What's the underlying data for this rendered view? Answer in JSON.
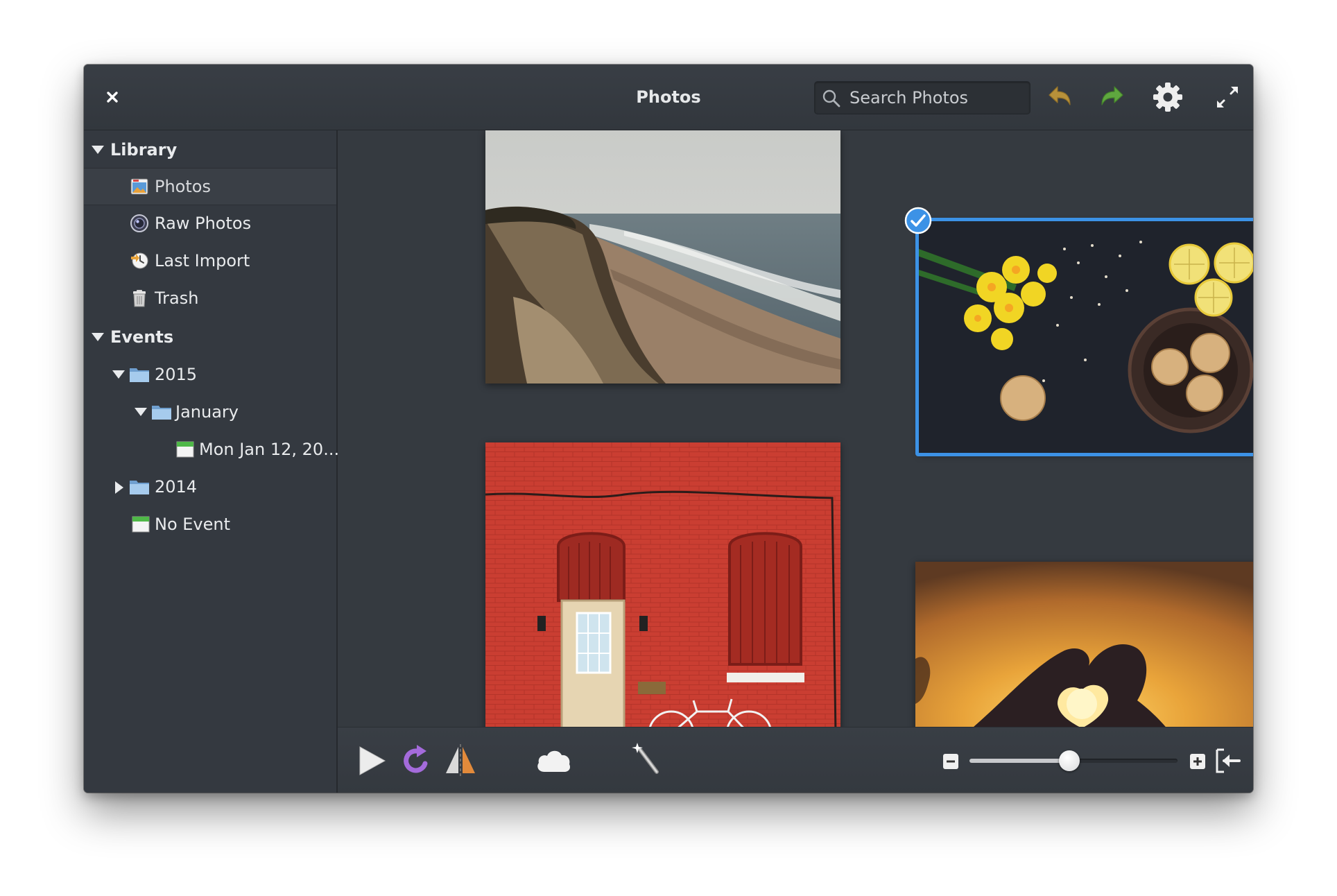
{
  "window": {
    "title": "Photos"
  },
  "header": {
    "close_icon": "close-icon",
    "search_placeholder": "Search Photos",
    "search_value": "",
    "icons": [
      "undo-icon",
      "redo-icon",
      "gear-icon",
      "fullscreen-icon"
    ],
    "colors": {
      "undo": "#b8913a",
      "redo": "#5fa73f"
    }
  },
  "sidebar": {
    "library": {
      "label": "Library",
      "expanded": true,
      "items": [
        {
          "label": "Photos",
          "icon": "photos-icon",
          "selected": true
        },
        {
          "label": "Raw Photos",
          "icon": "camera-lens-icon",
          "selected": false
        },
        {
          "label": "Last Import",
          "icon": "import-clock-icon",
          "selected": false
        },
        {
          "label": "Trash",
          "icon": "trash-icon",
          "selected": false
        }
      ]
    },
    "events": {
      "label": "Events",
      "expanded": true,
      "years": [
        {
          "label": "2015",
          "expanded": true,
          "icon": "folder-icon",
          "months": [
            {
              "label": "January",
              "expanded": true,
              "icon": "folder-icon",
              "days": [
                {
                  "label": "Mon Jan 12, 20...",
                  "icon": "event-icon"
                }
              ]
            }
          ]
        },
        {
          "label": "2014",
          "expanded": false,
          "icon": "folder-icon"
        }
      ],
      "no_event": {
        "label": "No Event",
        "icon": "event-icon"
      }
    }
  },
  "content": {
    "photos": [
      {
        "name": "coast-cliff",
        "selected": false
      },
      {
        "name": "flowers-cookies",
        "selected": true
      },
      {
        "name": "red-brick-wall",
        "selected": false
      },
      {
        "name": "heart-hands-sunset",
        "selected": false
      }
    ]
  },
  "toolbar": {
    "icons": [
      "play-icon",
      "rotate-icon",
      "flip-icon",
      "cloud-icon",
      "magic-wand-icon",
      "zoom-out-icon",
      "zoom-in-icon",
      "export-icon"
    ],
    "zoom_level": 0.48,
    "accent": "#3c92e6"
  }
}
